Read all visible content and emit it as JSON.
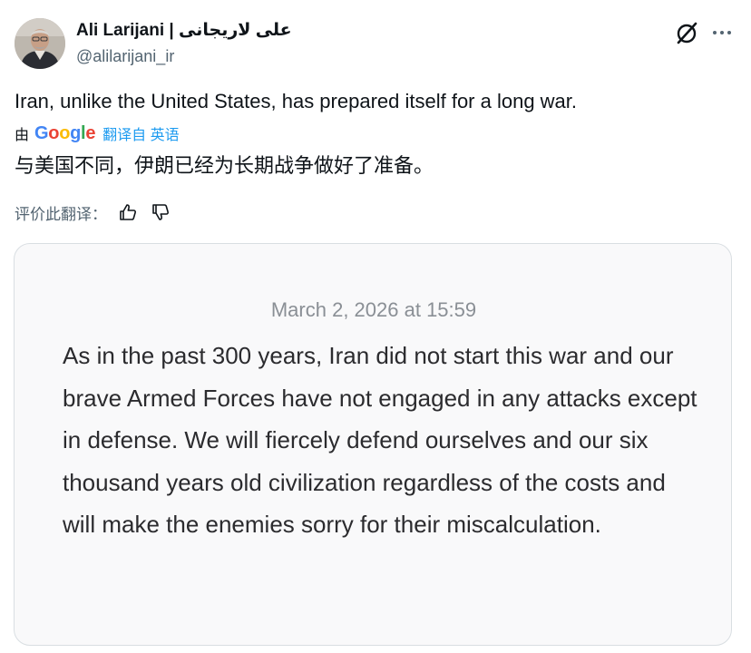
{
  "author": {
    "name": "Ali Larijani | علی لاریجانی",
    "handle": "@alilarijani_ir"
  },
  "icons": {
    "grok": "grok-icon",
    "more": "more-icon",
    "thumbs_up": "thumbs-up-icon",
    "thumbs_down": "thumbs-down-icon"
  },
  "tweet": {
    "text": "Iran, unlike the United States, has prepared itself for a long war."
  },
  "translation": {
    "by_prefix": "由",
    "google": [
      "G",
      "o",
      "o",
      "g",
      "l",
      "e"
    ],
    "link_label": "翻译自 英语",
    "translated_text": "与美国不同，伊朗已经为长期战争做好了准备。",
    "rate_label": "评价此翻译："
  },
  "media": {
    "date": "March 2, 2026 at 15:59",
    "statement": "As in the past 300 years, Iran did not start this war and our brave Armed Forces have not engaged in any attacks except in defense. We will fiercely defend ourselves and our six thousand years old civilization regardless of the costs and will make the enemies sorry for their miscalculation."
  },
  "colors": {
    "text_primary": "#0f1419",
    "text_secondary": "#536471",
    "link": "#1d9bf0",
    "google_blue": "#4285f4",
    "google_red": "#ea4335",
    "google_yellow": "#fbbc05",
    "google_green": "#34a853"
  }
}
